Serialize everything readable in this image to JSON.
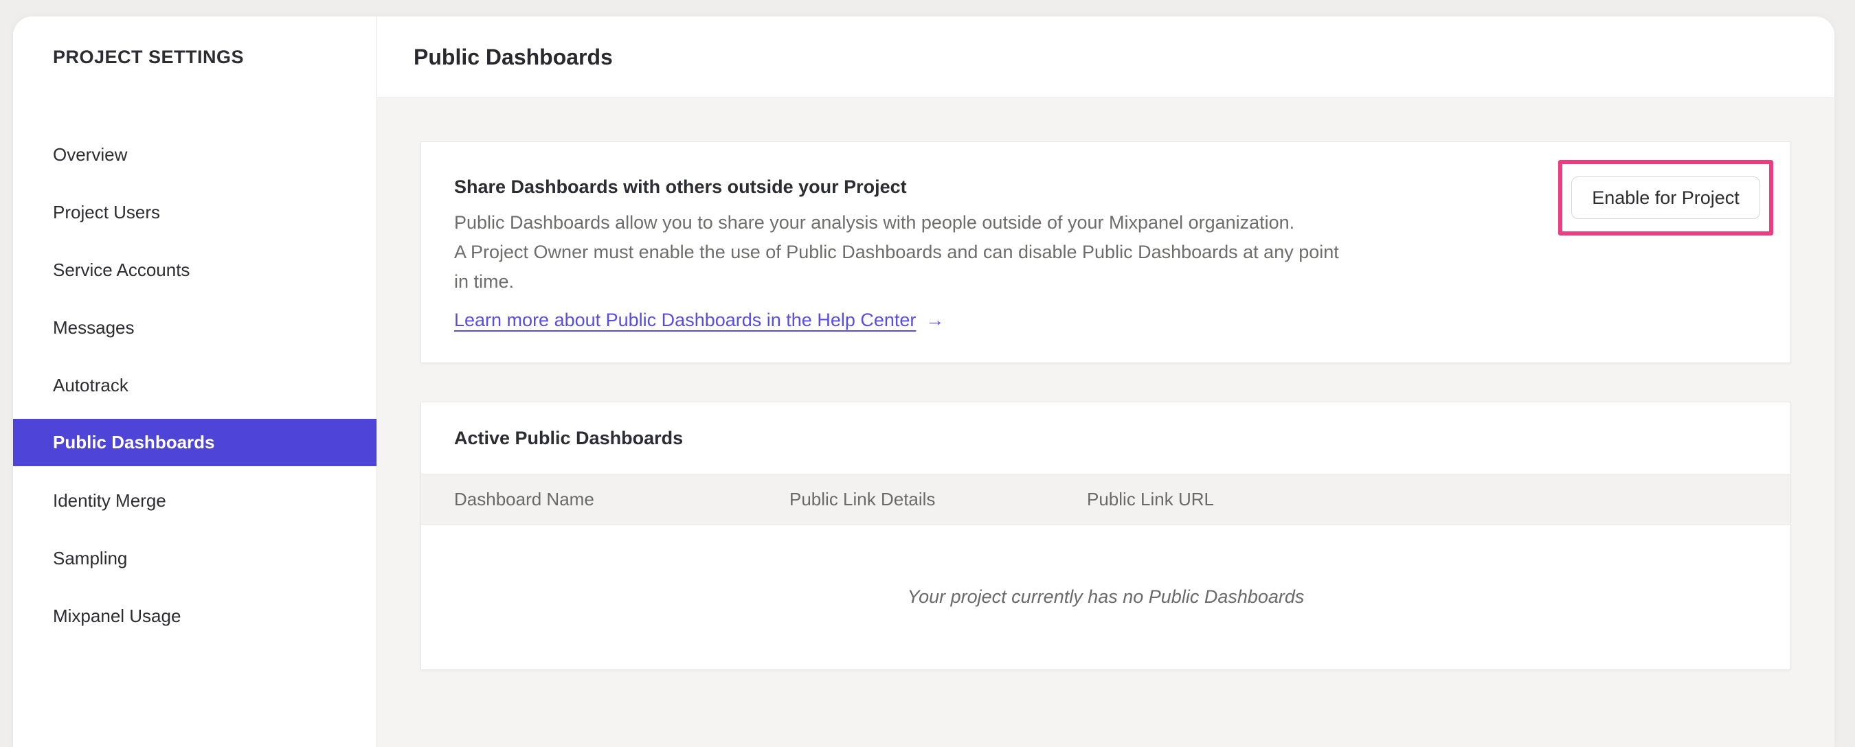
{
  "sidebar": {
    "title": "PROJECT SETTINGS",
    "items": [
      {
        "label": "Overview",
        "selected": false
      },
      {
        "label": "Project Users",
        "selected": false
      },
      {
        "label": "Service Accounts",
        "selected": false
      },
      {
        "label": "Messages",
        "selected": false
      },
      {
        "label": "Autotrack",
        "selected": false
      },
      {
        "label": "Public Dashboards",
        "selected": true
      },
      {
        "label": "Identity Merge",
        "selected": false
      },
      {
        "label": "Sampling",
        "selected": false
      },
      {
        "label": "Mixpanel Usage",
        "selected": false
      }
    ]
  },
  "header": {
    "title": "Public Dashboards"
  },
  "share_card": {
    "heading": "Share Dashboards with others outside your Project",
    "body_lines": [
      "Public Dashboards allow you to share your analysis with people outside of your Mixpanel organization.",
      "A Project Owner must enable the use of Public Dashboards and can disable Public Dashboards at any point",
      "in time."
    ],
    "link_label": "Learn more about Public Dashboards in the Help Center",
    "link_arrow": "→",
    "enable_button_label": "Enable for Project"
  },
  "active_card": {
    "heading": "Active Public Dashboards",
    "columns": [
      "Dashboard Name",
      "Public Link Details",
      "Public Link URL"
    ],
    "empty_message": "Your project currently has no Public Dashboards"
  },
  "colors": {
    "accent_purple": "#4f44d8",
    "link_purple": "#564ee4",
    "highlight_pink": "#eb3d80",
    "selected_text": "#ffffff"
  }
}
